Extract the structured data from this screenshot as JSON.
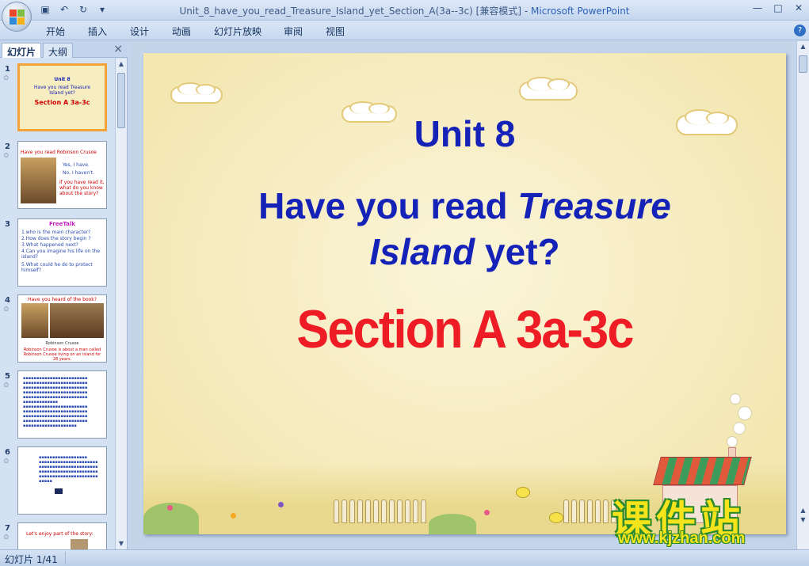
{
  "window": {
    "title_doc": "Unit_8_have_you_read_Treasure_Island_yet_Section_A(3a--3c) [兼容模式]",
    "title_sep": " - ",
    "title_app": "Microsoft PowerPoint",
    "controls": [
      "minimize",
      "maximize",
      "close"
    ]
  },
  "qat": {
    "icons": [
      "save-icon",
      "undo-icon",
      "redo-icon",
      "customize-icon"
    ]
  },
  "ribbon": {
    "tabs": [
      "开始",
      "插入",
      "设计",
      "动画",
      "幻灯片放映",
      "审阅",
      "视图"
    ],
    "help_label": "?"
  },
  "leftpane": {
    "tab_slides": "幻灯片",
    "tab_outline": "大纲",
    "close_label": "×",
    "thumbnails": [
      {
        "num": "1",
        "line1": "Unit 8",
        "line2": "Have you read Treasure",
        "line3": "Island yet?",
        "line4": "Section A 3a-3c"
      },
      {
        "num": "2",
        "line1": "Have you read Robinson Crusoe",
        "line2": "Yes, I have.",
        "line3": "No, I haven't.",
        "line4": "If you have read it, what do you know about the story?"
      },
      {
        "num": "3",
        "line1": "FreeTalk",
        "line2": "1.who is the main character?",
        "line3": "2.How does the story begin ?",
        "line4": "3.What happened next?",
        "line5": "4.Can you imagine his life on the island?",
        "line6": "5.What could he do to protect himself?"
      },
      {
        "num": "4",
        "line1": "Have you heard of the book?",
        "line2": "Robinson Crusoe",
        "line3": "Robinson Crusoe is about a man called Robinson Crusoe living on an island for 28 years."
      },
      {
        "num": "5"
      },
      {
        "num": "6"
      },
      {
        "num": "7",
        "line1": "Let's enjoy part of the story:"
      }
    ]
  },
  "slide": {
    "unit": "Unit 8",
    "q_part1": "Have you read ",
    "q_italic1": "Treasure",
    "q_italic2": "Island",
    "q_part2": " yet?",
    "section": "Section A 3a-3c"
  },
  "watermark": {
    "cn": "课件站",
    "url": "www.kjzhan.com"
  },
  "status": {
    "slide_count": "幻灯片 1/41"
  },
  "colors": {
    "title_blue": "#1522b8",
    "section_red": "#ee1c25",
    "selection_orange": "#f3a33a"
  }
}
